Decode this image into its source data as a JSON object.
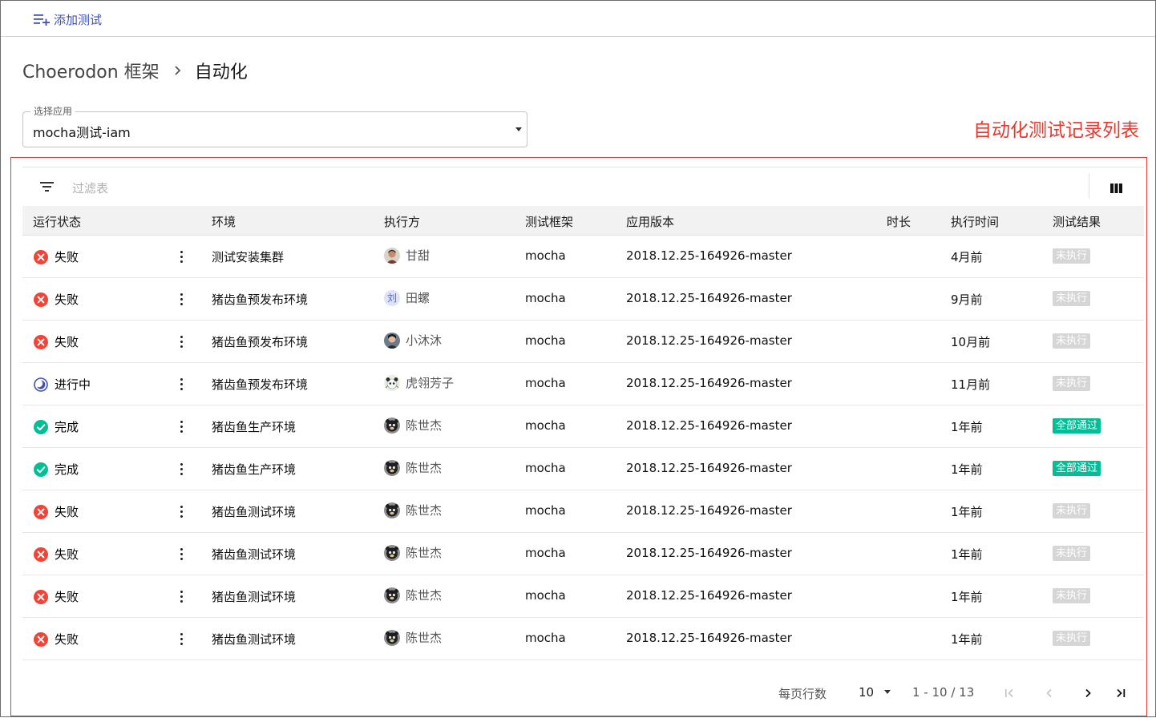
{
  "toolbar": {
    "add_test_label": "添加测试"
  },
  "breadcrumb": {
    "parent": "Choerodon 框架",
    "current": "自动化"
  },
  "app_select": {
    "label": "选择应用",
    "value": "mocha测试-iam"
  },
  "annotation": "自动化测试记录列表",
  "filter": {
    "placeholder": "过滤表"
  },
  "colors": {
    "accent": "#3f51b5",
    "annotation_red": "#e8382e",
    "fail": "#f44336",
    "success": "#00bf96",
    "running": "#3f51b5",
    "badge_not_run": "#d6d6d6",
    "badge_pass": "#00bf96"
  },
  "columns": [
    "运行状态",
    "环境",
    "执行方",
    "测试框架",
    "应用版本",
    "时长",
    "执行时间",
    "测试结果"
  ],
  "rows": [
    {
      "status": "失败",
      "status_type": "fail",
      "env": "测试安装集群",
      "executor": "甘甜",
      "avatar": "photo-man",
      "framework": "mocha",
      "version": "2018.12.25-164926-master",
      "duration": "",
      "time": "4月前",
      "result": "未执行",
      "result_type": "not-run"
    },
    {
      "status": "失败",
      "status_type": "fail",
      "env": "猪齿鱼预发布环境",
      "executor": "田螺",
      "avatar": "letter",
      "avatar_letter": "刘",
      "framework": "mocha",
      "version": "2018.12.25-164926-master",
      "duration": "",
      "time": "9月前",
      "result": "未执行",
      "result_type": "not-run"
    },
    {
      "status": "失败",
      "status_type": "fail",
      "env": "猪齿鱼预发布环境",
      "executor": "小沐沐",
      "avatar": "photo-dark",
      "framework": "mocha",
      "version": "2018.12.25-164926-master",
      "duration": "",
      "time": "10月前",
      "result": "未执行",
      "result_type": "not-run"
    },
    {
      "status": "进行中",
      "status_type": "running",
      "env": "猪齿鱼预发布环境",
      "executor": "虎翎芳子",
      "avatar": "photo-panda",
      "framework": "mocha",
      "version": "2018.12.25-164926-master",
      "duration": "",
      "time": "11月前",
      "result": "未执行",
      "result_type": "not-run"
    },
    {
      "status": "完成",
      "status_type": "success",
      "env": "猪齿鱼生产环境",
      "executor": "陈世杰",
      "avatar": "photo-bear",
      "framework": "mocha",
      "version": "2018.12.25-164926-master",
      "duration": "",
      "time": "1年前",
      "result": "全部通过",
      "result_type": "pass"
    },
    {
      "status": "完成",
      "status_type": "success",
      "env": "猪齿鱼生产环境",
      "executor": "陈世杰",
      "avatar": "photo-bear",
      "framework": "mocha",
      "version": "2018.12.25-164926-master",
      "duration": "",
      "time": "1年前",
      "result": "全部通过",
      "result_type": "pass"
    },
    {
      "status": "失败",
      "status_type": "fail",
      "env": "猪齿鱼测试环境",
      "executor": "陈世杰",
      "avatar": "photo-bear",
      "framework": "mocha",
      "version": "2018.12.25-164926-master",
      "duration": "",
      "time": "1年前",
      "result": "未执行",
      "result_type": "not-run"
    },
    {
      "status": "失败",
      "status_type": "fail",
      "env": "猪齿鱼测试环境",
      "executor": "陈世杰",
      "avatar": "photo-bear",
      "framework": "mocha",
      "version": "2018.12.25-164926-master",
      "duration": "",
      "time": "1年前",
      "result": "未执行",
      "result_type": "not-run"
    },
    {
      "status": "失败",
      "status_type": "fail",
      "env": "猪齿鱼测试环境",
      "executor": "陈世杰",
      "avatar": "photo-bear",
      "framework": "mocha",
      "version": "2018.12.25-164926-master",
      "duration": "",
      "time": "1年前",
      "result": "未执行",
      "result_type": "not-run"
    },
    {
      "status": "失败",
      "status_type": "fail",
      "env": "猪齿鱼测试环境",
      "executor": "陈世杰",
      "avatar": "photo-bear",
      "framework": "mocha",
      "version": "2018.12.25-164926-master",
      "duration": "",
      "time": "1年前",
      "result": "未执行",
      "result_type": "not-run"
    }
  ],
  "pagination": {
    "rows_per_page_label": "每页行数",
    "rows_per_page": "10",
    "range": "1 - 10 / 13"
  }
}
